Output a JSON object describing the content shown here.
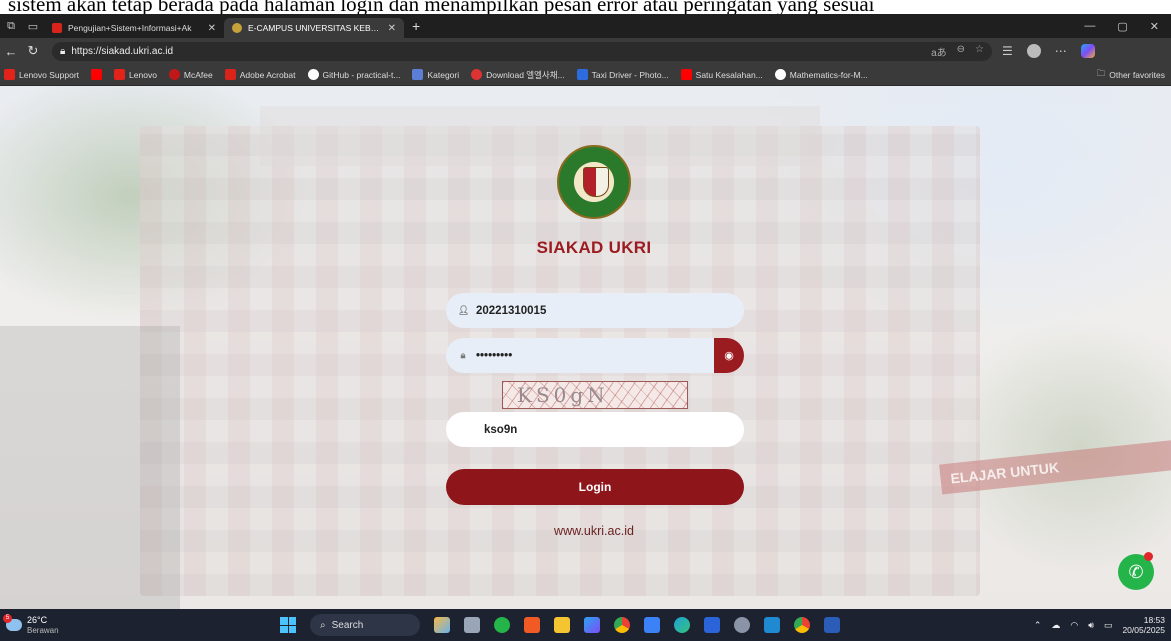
{
  "doc_snippet": "sistem akan tetap berada pada halaman login dan menampilkan pesan error atau peringatan yang sesuai",
  "browser": {
    "tabs": [
      {
        "title": "Pengujian+Sistem+Informasi+Ak",
        "active": false
      },
      {
        "title": "E-CAMPUS UNIVERSITAS KEBANG",
        "active": true
      }
    ],
    "new_tab": "+",
    "url": "https://siakad.ukri.ac.id",
    "bookmarks": [
      {
        "label": "Lenovo Support",
        "color": "#e2231a"
      },
      {
        "label": "",
        "color": "#ff0000"
      },
      {
        "label": "Lenovo",
        "color": "#e2231a"
      },
      {
        "label": "McAfee",
        "color": "#c01818"
      },
      {
        "label": "Adobe Acrobat",
        "color": "#d9241c"
      },
      {
        "label": "GitHub - practical-t...",
        "color": "#ffffff"
      },
      {
        "label": "Kategori",
        "color": "#5b7fd6"
      },
      {
        "label": "Download 엘엘사채...",
        "color": "#d33"
      },
      {
        "label": "Taxi Driver - Photo...",
        "color": "#2d6cdf"
      },
      {
        "label": "Satu Kesalahan...",
        "color": "#ff0000"
      },
      {
        "label": "Mathematics-for-M...",
        "color": "#ffffff"
      }
    ],
    "other_favorites": "Other favorites"
  },
  "login": {
    "title": "SIAKAD UKRI",
    "username_value": "20221310015",
    "password_value": "•••••••••",
    "captcha_text": "KS0gN",
    "captcha_input_value": "kso9n",
    "login_button": "Login",
    "footer_link": "www.ukri.ac.id",
    "accent_color": "#9b1c20"
  },
  "background_banner": "ELAJAR UNTUK",
  "taskbar": {
    "temperature": "26°C",
    "weather": "Berawan",
    "weather_badge": "5",
    "search_label": "Search",
    "time": "18:53",
    "date": "20/05/2025"
  }
}
